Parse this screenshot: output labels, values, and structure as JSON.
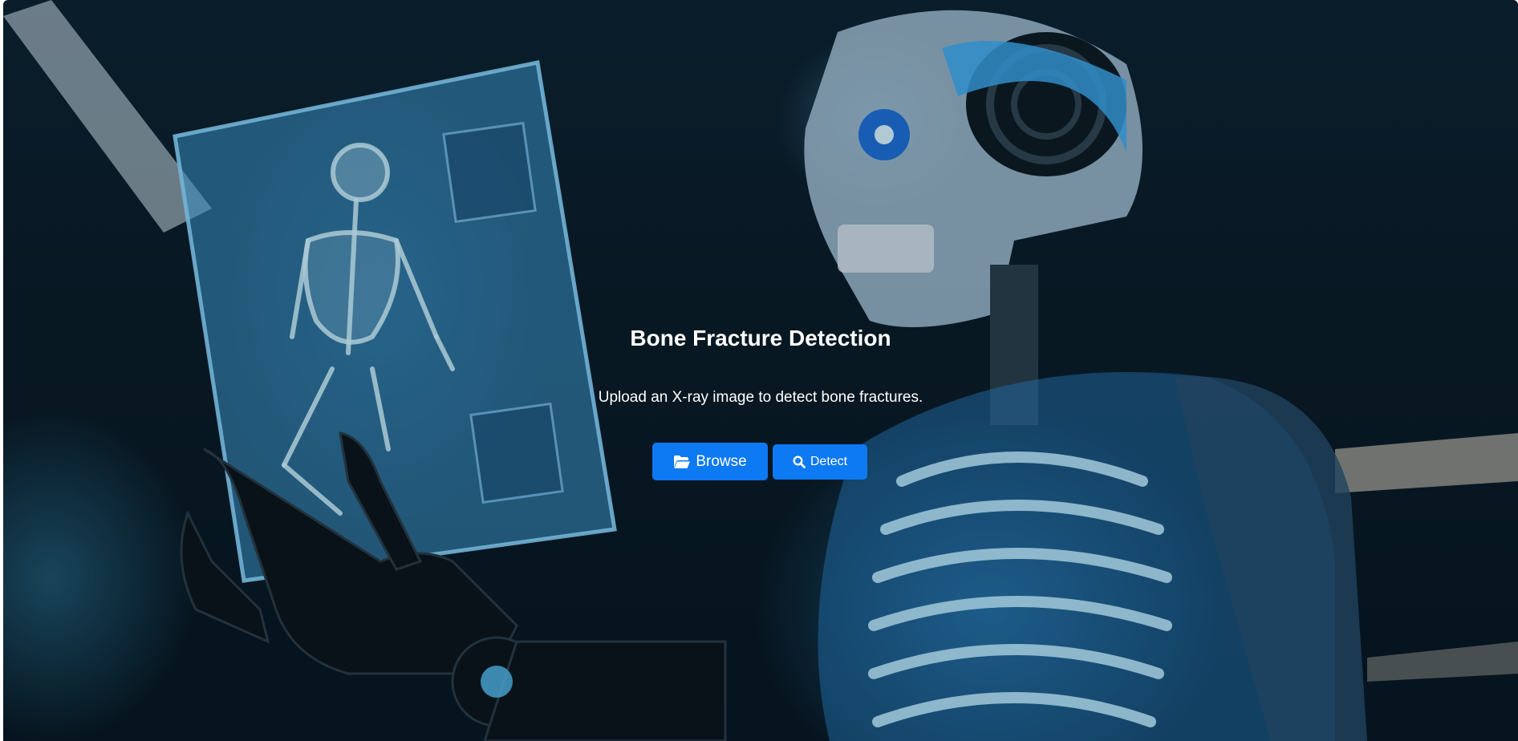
{
  "hero": {
    "title": "Bone Fracture Detection",
    "subtitle": "Upload an X-ray image to detect bone fractures."
  },
  "actions": {
    "browse_label": "Browse",
    "browse_icon": "folder-open-icon",
    "detect_label": "Detect",
    "detect_icon": "search-icon"
  },
  "colors": {
    "button": "#0d79f2",
    "text": "#ffffff"
  }
}
